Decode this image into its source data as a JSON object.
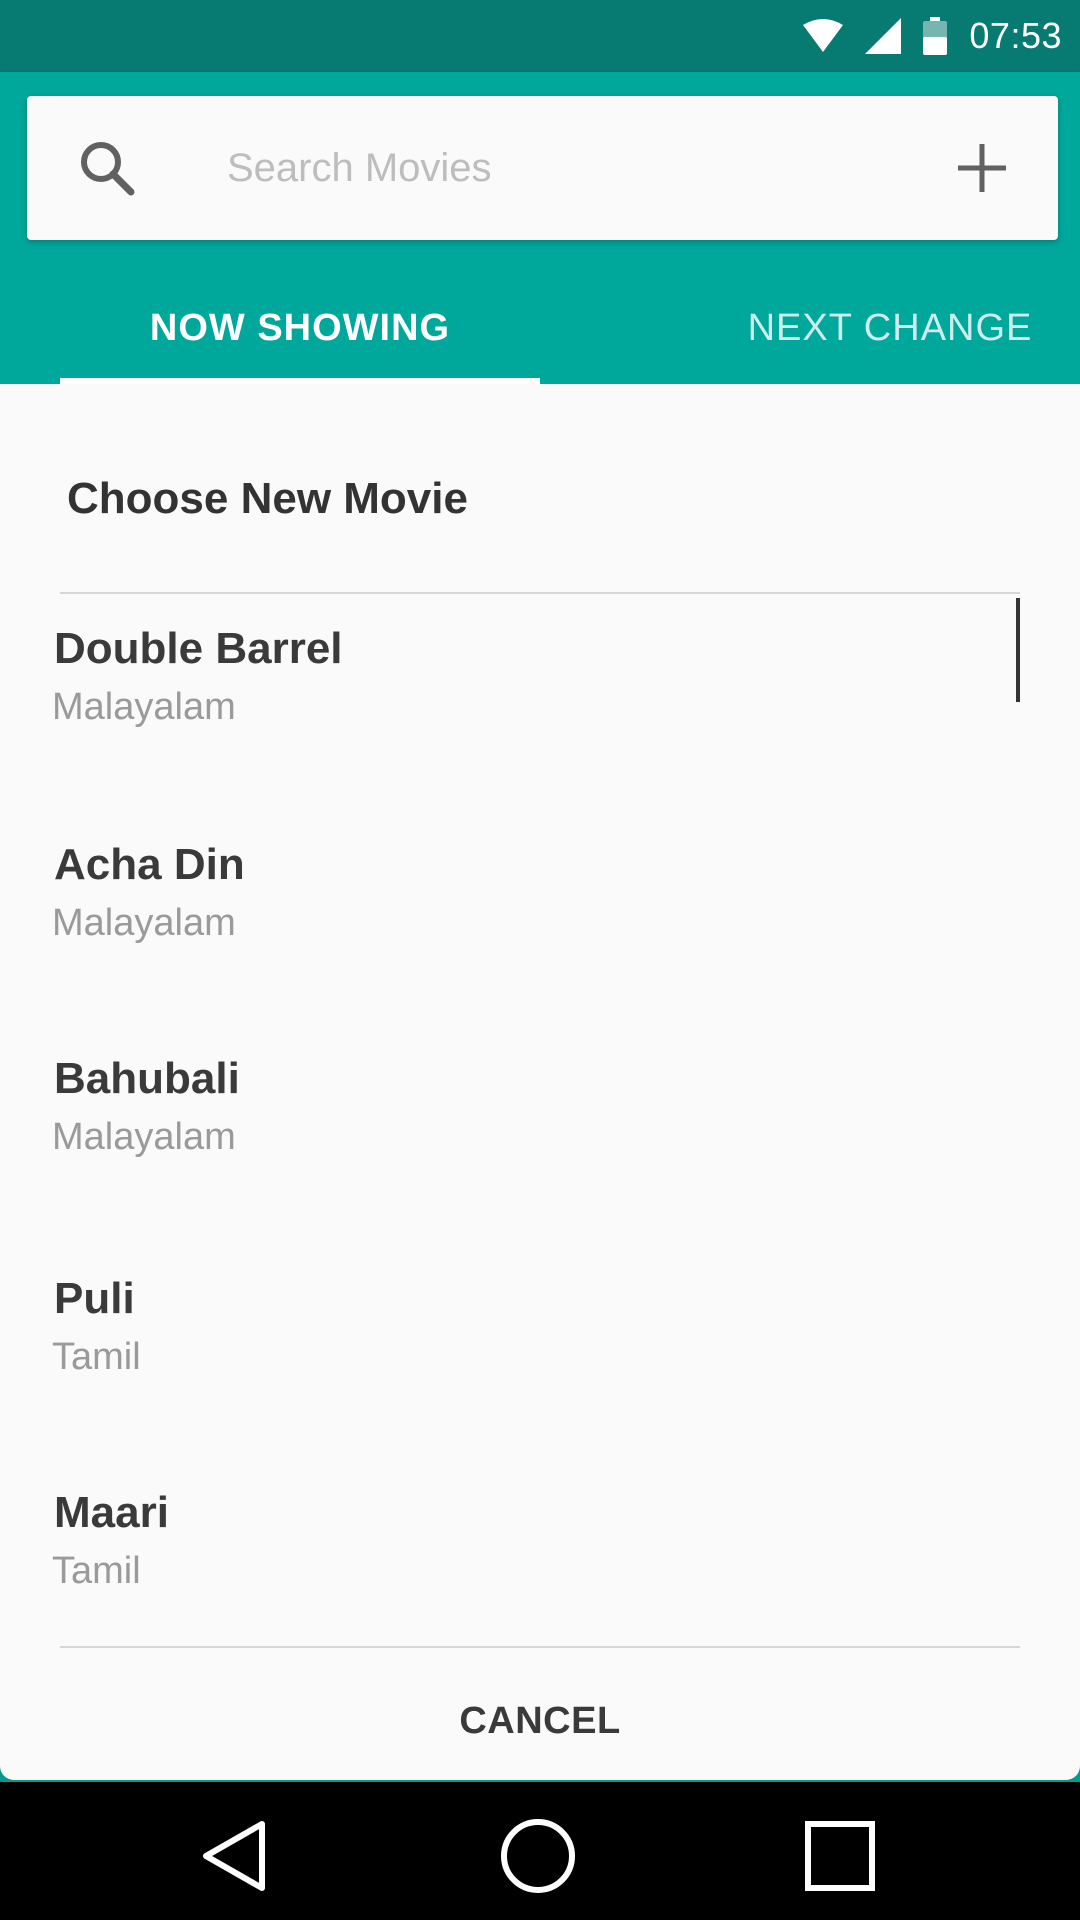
{
  "status_bar": {
    "time": "07:53",
    "icons": [
      "wifi-icon",
      "signal-icon",
      "battery-icon"
    ]
  },
  "search": {
    "placeholder": "Search Movies",
    "value": "",
    "left_icon": "search-icon",
    "right_icon": "add-icon"
  },
  "tabs": [
    {
      "label": "NOW SHOWING",
      "selected": true
    },
    {
      "label": "NEXT CHANGE",
      "selected": false
    }
  ],
  "dialog": {
    "title": "Choose New Movie",
    "movies": [
      {
        "title": "Double Barrel",
        "language": "Malayalam"
      },
      {
        "title": "Acha Din",
        "language": "Malayalam"
      },
      {
        "title": "Bahubali",
        "language": "Malayalam"
      },
      {
        "title": "Puli",
        "language": "Tamil"
      },
      {
        "title": "Maari",
        "language": "Tamil"
      }
    ],
    "cancel_label": "CANCEL"
  },
  "nav_bar": {
    "icons": [
      "back-icon",
      "home-icon",
      "recents-icon"
    ]
  },
  "colors": {
    "primary": "#00a79b",
    "primary_dark": "#077a71",
    "surface": "#fafafa",
    "text_primary": "#333333",
    "text_secondary": "#9a9a9a"
  }
}
